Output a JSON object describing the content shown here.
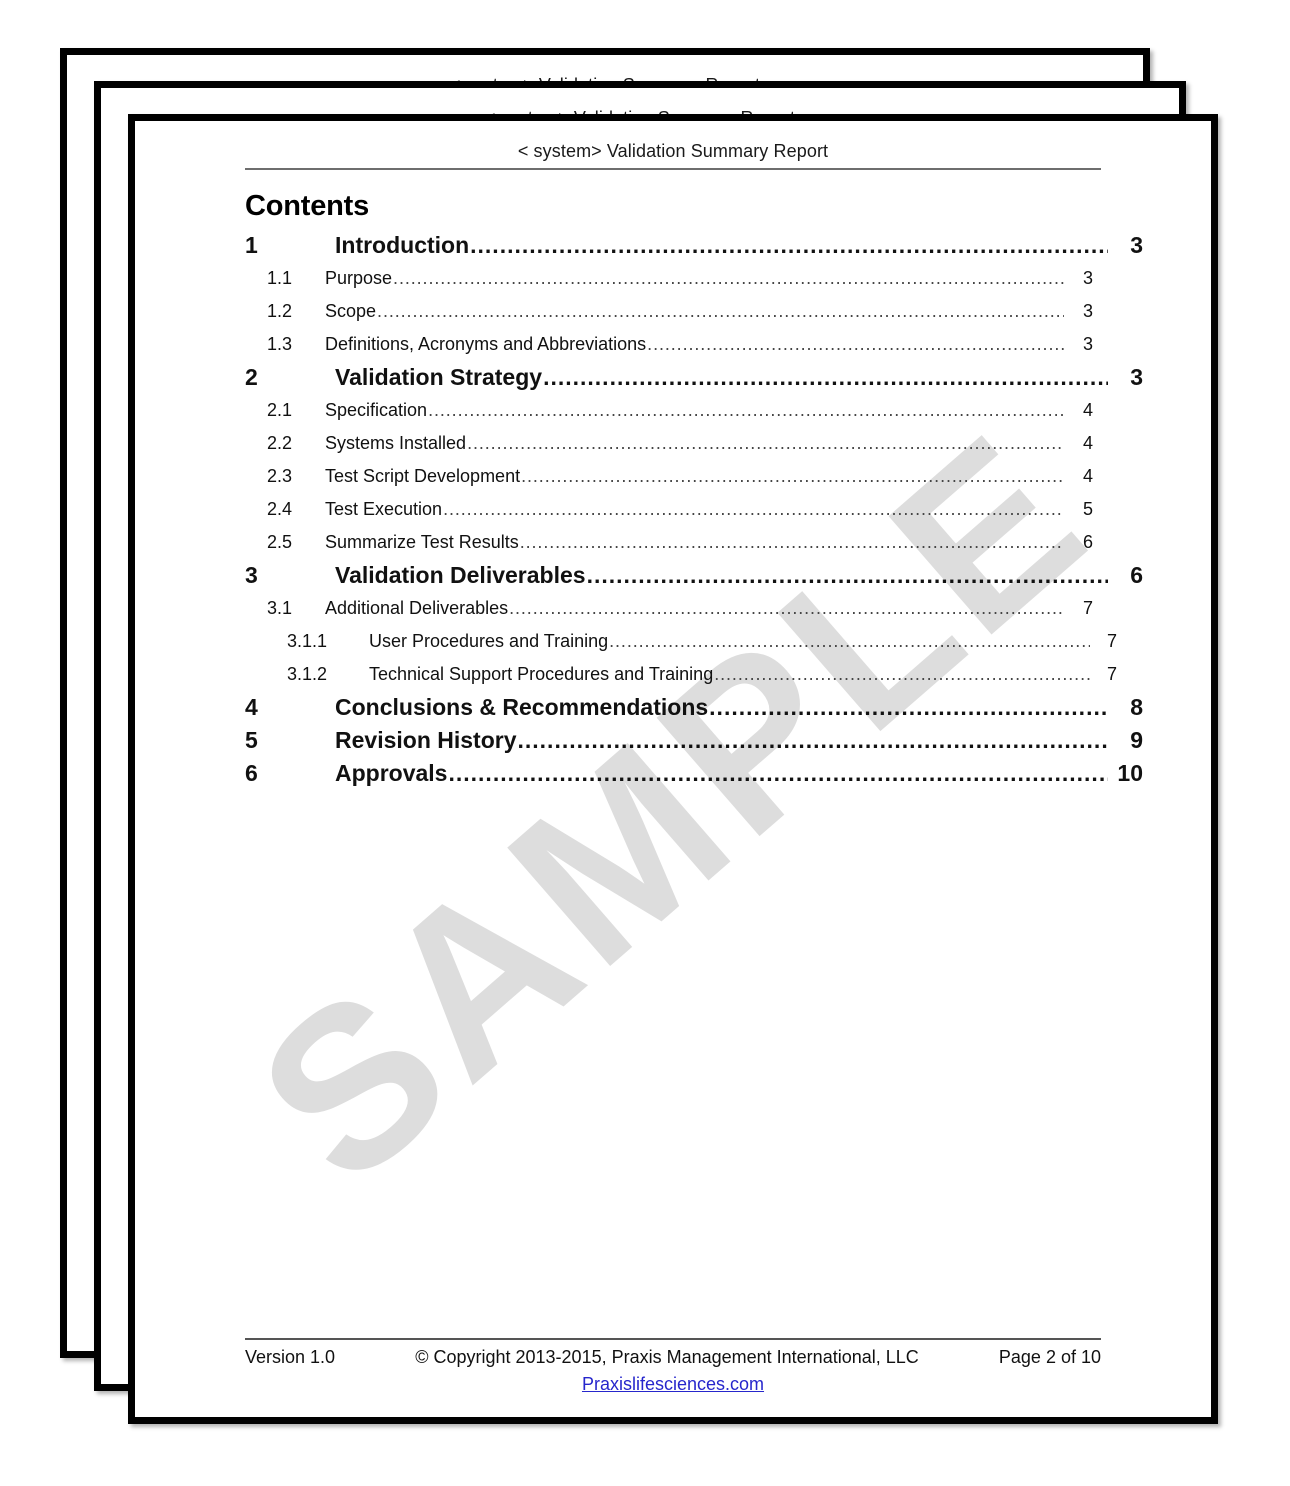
{
  "document": {
    "running_head": "< system> Validation Summary Report",
    "watermark": "SAMPLE"
  },
  "toc": {
    "title": "Contents",
    "entries": [
      {
        "level": 1,
        "number": "1",
        "label": "Introduction",
        "page": "3"
      },
      {
        "level": 2,
        "number": "1.1",
        "label": "Purpose",
        "page": "3"
      },
      {
        "level": 2,
        "number": "1.2",
        "label": "Scope",
        "page": "3"
      },
      {
        "level": 2,
        "number": "1.3",
        "label": "Definitions, Acronyms and Abbreviations",
        "page": "3"
      },
      {
        "level": 1,
        "number": "2",
        "label": "Validation Strategy",
        "page": "3"
      },
      {
        "level": 2,
        "number": "2.1",
        "label": "Specification",
        "page": "4"
      },
      {
        "level": 2,
        "number": "2.2",
        "label": "Systems Installed",
        "page": "4"
      },
      {
        "level": 2,
        "number": "2.3",
        "label": "Test Script Development",
        "page": "4"
      },
      {
        "level": 2,
        "number": "2.4",
        "label": "Test Execution",
        "page": "5"
      },
      {
        "level": 2,
        "number": "2.5",
        "label": "Summarize Test Results",
        "page": "6"
      },
      {
        "level": 1,
        "number": "3",
        "label": "Validation Deliverables",
        "page": "6"
      },
      {
        "level": 2,
        "number": "3.1",
        "label": "Additional Deliverables",
        "page": "7"
      },
      {
        "level": 3,
        "number": "3.1.1",
        "label": "User Procedures and Training",
        "page": "7"
      },
      {
        "level": 3,
        "number": "3.1.2",
        "label": "Technical Support Procedures and Training",
        "page": "7"
      },
      {
        "level": 1,
        "number": "4",
        "label": "Conclusions & Recommendations",
        "page": "8"
      },
      {
        "level": 1,
        "number": "5",
        "label": "Revision History",
        "page": "9"
      },
      {
        "level": 1,
        "number": "6",
        "label": "Approvals",
        "page": "10"
      }
    ]
  },
  "footer": {
    "version": "Version 1.0",
    "copyright": "© Copyright 2013-2015, Praxis Management International, LLC",
    "page_label": "Page 2 of 10",
    "url": "Praxislifesciences.com",
    "url_color": "#2626cc"
  },
  "stack": {
    "sheets": [
      {
        "id": "back",
        "z": 1
      },
      {
        "id": "middle",
        "z": 2
      },
      {
        "id": "front",
        "z": 3
      }
    ]
  }
}
